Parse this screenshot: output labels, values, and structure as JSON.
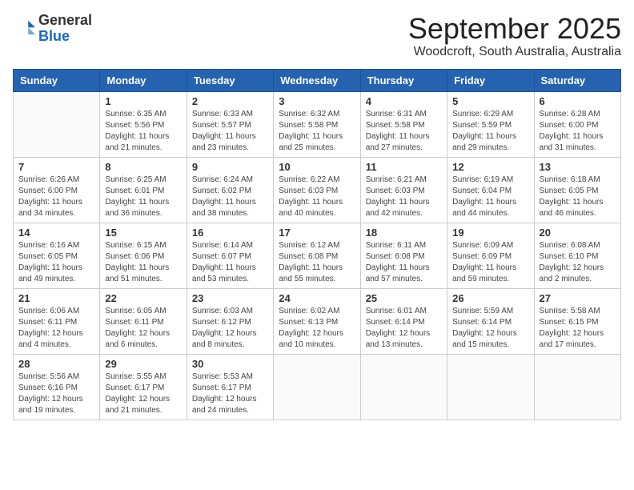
{
  "header": {
    "logo": {
      "general": "General",
      "blue": "Blue"
    },
    "title": "September 2025",
    "subtitle": "Woodcroft, South Australia, Australia"
  },
  "calendar": {
    "days": [
      "Sunday",
      "Monday",
      "Tuesday",
      "Wednesday",
      "Thursday",
      "Friday",
      "Saturday"
    ],
    "weeks": [
      [
        {
          "date": "",
          "info": ""
        },
        {
          "date": "1",
          "info": "Sunrise: 6:35 AM\nSunset: 5:56 PM\nDaylight: 11 hours\nand 21 minutes."
        },
        {
          "date": "2",
          "info": "Sunrise: 6:33 AM\nSunset: 5:57 PM\nDaylight: 11 hours\nand 23 minutes."
        },
        {
          "date": "3",
          "info": "Sunrise: 6:32 AM\nSunset: 5:58 PM\nDaylight: 11 hours\nand 25 minutes."
        },
        {
          "date": "4",
          "info": "Sunrise: 6:31 AM\nSunset: 5:58 PM\nDaylight: 11 hours\nand 27 minutes."
        },
        {
          "date": "5",
          "info": "Sunrise: 6:29 AM\nSunset: 5:59 PM\nDaylight: 11 hours\nand 29 minutes."
        },
        {
          "date": "6",
          "info": "Sunrise: 6:28 AM\nSunset: 6:00 PM\nDaylight: 11 hours\nand 31 minutes."
        }
      ],
      [
        {
          "date": "7",
          "info": "Sunrise: 6:26 AM\nSunset: 6:00 PM\nDaylight: 11 hours\nand 34 minutes."
        },
        {
          "date": "8",
          "info": "Sunrise: 6:25 AM\nSunset: 6:01 PM\nDaylight: 11 hours\nand 36 minutes."
        },
        {
          "date": "9",
          "info": "Sunrise: 6:24 AM\nSunset: 6:02 PM\nDaylight: 11 hours\nand 38 minutes."
        },
        {
          "date": "10",
          "info": "Sunrise: 6:22 AM\nSunset: 6:03 PM\nDaylight: 11 hours\nand 40 minutes."
        },
        {
          "date": "11",
          "info": "Sunrise: 6:21 AM\nSunset: 6:03 PM\nDaylight: 11 hours\nand 42 minutes."
        },
        {
          "date": "12",
          "info": "Sunrise: 6:19 AM\nSunset: 6:04 PM\nDaylight: 11 hours\nand 44 minutes."
        },
        {
          "date": "13",
          "info": "Sunrise: 6:18 AM\nSunset: 6:05 PM\nDaylight: 11 hours\nand 46 minutes."
        }
      ],
      [
        {
          "date": "14",
          "info": "Sunrise: 6:16 AM\nSunset: 6:05 PM\nDaylight: 11 hours\nand 49 minutes."
        },
        {
          "date": "15",
          "info": "Sunrise: 6:15 AM\nSunset: 6:06 PM\nDaylight: 11 hours\nand 51 minutes."
        },
        {
          "date": "16",
          "info": "Sunrise: 6:14 AM\nSunset: 6:07 PM\nDaylight: 11 hours\nand 53 minutes."
        },
        {
          "date": "17",
          "info": "Sunrise: 6:12 AM\nSunset: 6:08 PM\nDaylight: 11 hours\nand 55 minutes."
        },
        {
          "date": "18",
          "info": "Sunrise: 6:11 AM\nSunset: 6:08 PM\nDaylight: 11 hours\nand 57 minutes."
        },
        {
          "date": "19",
          "info": "Sunrise: 6:09 AM\nSunset: 6:09 PM\nDaylight: 11 hours\nand 59 minutes."
        },
        {
          "date": "20",
          "info": "Sunrise: 6:08 AM\nSunset: 6:10 PM\nDaylight: 12 hours\nand 2 minutes."
        }
      ],
      [
        {
          "date": "21",
          "info": "Sunrise: 6:06 AM\nSunset: 6:11 PM\nDaylight: 12 hours\nand 4 minutes."
        },
        {
          "date": "22",
          "info": "Sunrise: 6:05 AM\nSunset: 6:11 PM\nDaylight: 12 hours\nand 6 minutes."
        },
        {
          "date": "23",
          "info": "Sunrise: 6:03 AM\nSunset: 6:12 PM\nDaylight: 12 hours\nand 8 minutes."
        },
        {
          "date": "24",
          "info": "Sunrise: 6:02 AM\nSunset: 6:13 PM\nDaylight: 12 hours\nand 10 minutes."
        },
        {
          "date": "25",
          "info": "Sunrise: 6:01 AM\nSunset: 6:14 PM\nDaylight: 12 hours\nand 13 minutes."
        },
        {
          "date": "26",
          "info": "Sunrise: 5:59 AM\nSunset: 6:14 PM\nDaylight: 12 hours\nand 15 minutes."
        },
        {
          "date": "27",
          "info": "Sunrise: 5:58 AM\nSunset: 6:15 PM\nDaylight: 12 hours\nand 17 minutes."
        }
      ],
      [
        {
          "date": "28",
          "info": "Sunrise: 5:56 AM\nSunset: 6:16 PM\nDaylight: 12 hours\nand 19 minutes."
        },
        {
          "date": "29",
          "info": "Sunrise: 5:55 AM\nSunset: 6:17 PM\nDaylight: 12 hours\nand 21 minutes."
        },
        {
          "date": "30",
          "info": "Sunrise: 5:53 AM\nSunset: 6:17 PM\nDaylight: 12 hours\nand 24 minutes."
        },
        {
          "date": "",
          "info": ""
        },
        {
          "date": "",
          "info": ""
        },
        {
          "date": "",
          "info": ""
        },
        {
          "date": "",
          "info": ""
        }
      ]
    ]
  }
}
